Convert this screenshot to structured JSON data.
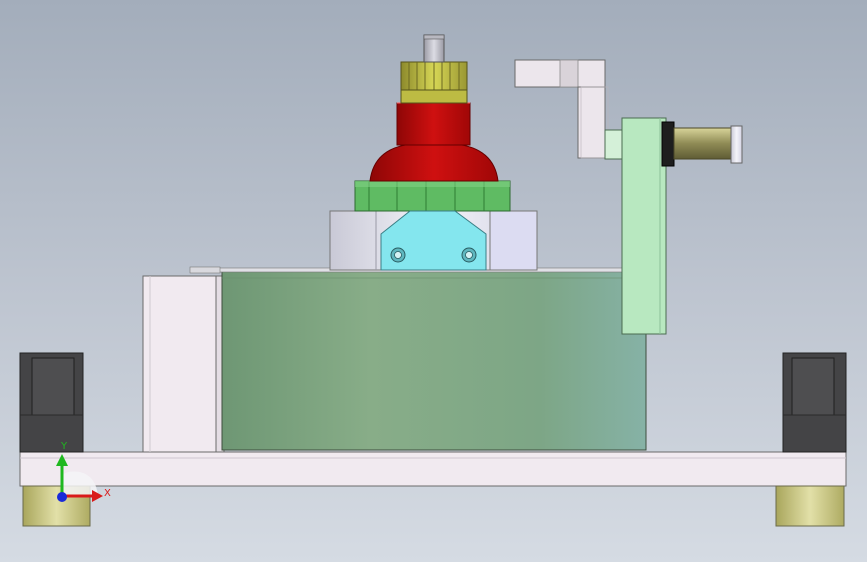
{
  "viewport": {
    "background_top": "#a3adbb",
    "background_bottom": "#d5dbe3"
  },
  "triad": {
    "x_label": "X",
    "y_label": "Y",
    "x_color": "#d91a1a",
    "y_color": "#1fb81f",
    "z_color": "#1a2bd9"
  },
  "parts": [
    {
      "name": "base-plate",
      "color": "#f1eaf0"
    },
    {
      "name": "green-drum",
      "color": "#7fa785"
    },
    {
      "name": "red-knob",
      "color": "#c10b0b"
    },
    {
      "name": "yellow-gear",
      "color": "#c8c84a"
    },
    {
      "name": "green-ring-gear",
      "color": "#5fbb63"
    },
    {
      "name": "cyan-block",
      "color": "#84e6ee"
    },
    {
      "name": "lever-arm",
      "color": "#b8e8c0"
    },
    {
      "name": "olive-pin",
      "color": "#8f8b55"
    },
    {
      "name": "crank-handle",
      "color": "#ece6ec"
    },
    {
      "name": "dark-foot-block",
      "color": "#3a3a3c"
    },
    {
      "name": "yellow-foot",
      "color": "#d1cf8c"
    }
  ]
}
